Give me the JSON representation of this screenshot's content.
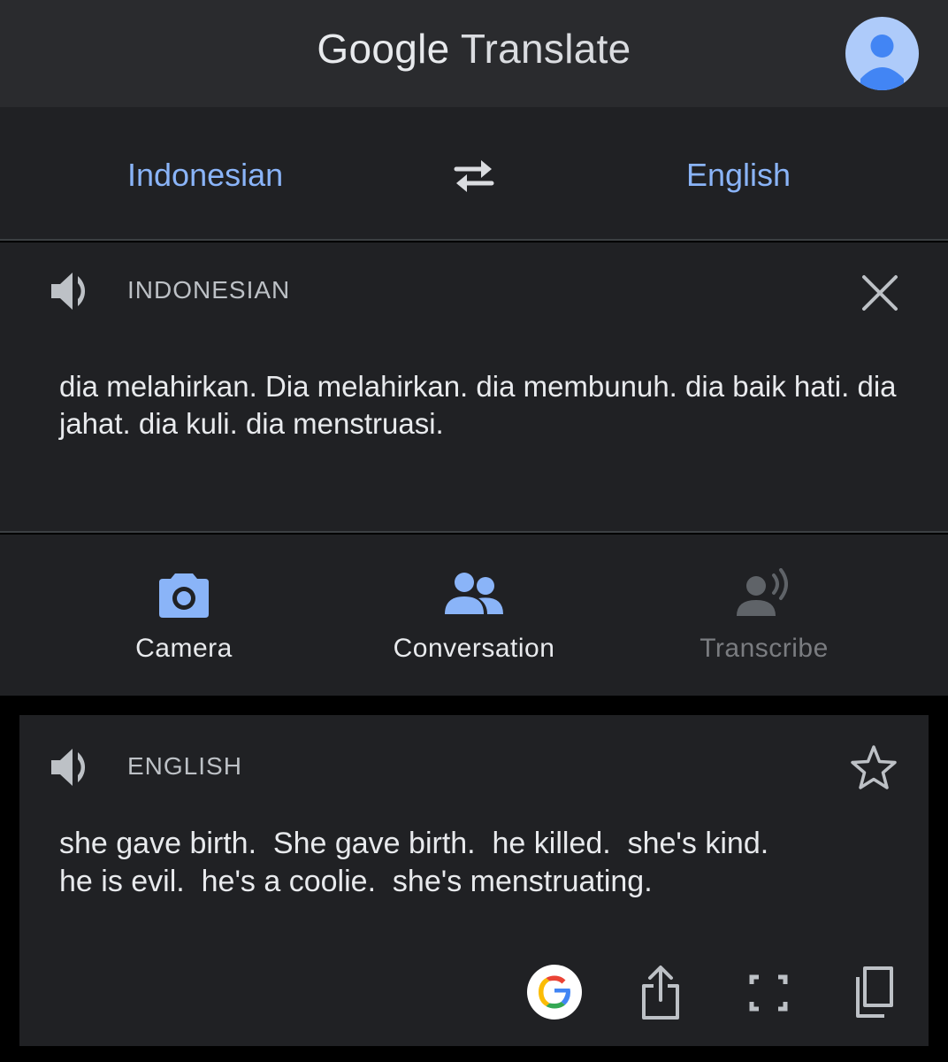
{
  "header": {
    "brand_google": "Google",
    "brand_translate": "Translate"
  },
  "languages": {
    "source": "Indonesian",
    "target": "English"
  },
  "input": {
    "label": "INDONESIAN",
    "text": "dia melahirkan. Dia melahirkan. dia membunuh. dia baik hati. dia jahat. dia kuli. dia menstruasi."
  },
  "tools": {
    "camera": "Camera",
    "conversation": "Conversation",
    "transcribe": "Transcribe"
  },
  "output": {
    "label": "ENGLISH",
    "text": "she gave birth.  She gave birth.  he killed.  she's kind.\nhe is evil.  he's a coolie.  she's menstruating."
  },
  "colors": {
    "accent": "#8ab4f8",
    "background": "#202124",
    "header": "#2a2b2e"
  }
}
